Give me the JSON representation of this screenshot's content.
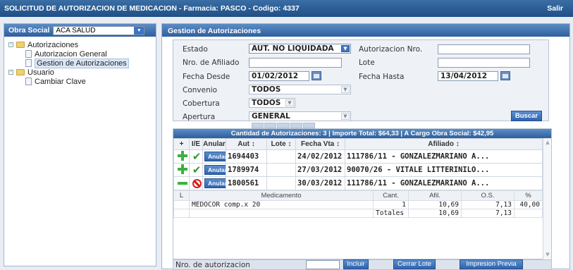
{
  "topbar": {
    "title": "SOLICITUD DE AUTORIZACION DE MEDICACION - Farmacia: PASCO - Codigo: 4337",
    "logout": "Salir"
  },
  "sidebar": {
    "obra_social_label": "Obra Social",
    "obra_social_value": "ACA SALUD",
    "tree": {
      "autorizaciones": "Autorizaciones",
      "autorizacion_general": "Autorizacion General",
      "gestion_autorizaciones": "Gestion de Autorizaciones",
      "usuario": "Usuario",
      "cambiar_clave": "Cambiar Clave"
    }
  },
  "main": {
    "title": "Gestion de Autorizaciones",
    "filters": {
      "estado_label": "Estado",
      "estado_value": "AUT. NO LIQUIDADA",
      "autorizacion_nro_label": "Autorizacion Nro.",
      "autorizacion_nro_value": "",
      "nro_afiliado_label": "Nro. de Afiliado",
      "nro_afiliado_value": "",
      "lote_label": "Lote",
      "lote_value": "",
      "fecha_desde_label": "Fecha Desde",
      "fecha_desde_value": "01/02/2012",
      "fecha_hasta_label": "Fecha Hasta",
      "fecha_hasta_value": "13/04/2012",
      "convenio_label": "Convenio",
      "convenio_value": "TODOS",
      "cobertura_label": "Cobertura",
      "cobertura_value": "TODOS",
      "apertura_label": "Apertura",
      "apertura_value": "GENERAL",
      "buscar": "Buscar"
    },
    "grid": {
      "summary": "Cantidad de Autorizaciones: 3 | Importe Total: $64,33 | A Cargo Obra Social: $42,95",
      "headers": {
        "expand": "+",
        "ie": "I/E",
        "anular": "Anular",
        "aut": "Aut ↕",
        "lote": "Lote ↕",
        "fecha_vta": "Fecha Vta ↕",
        "afiliado": "Afiliado ↕"
      },
      "anular_btn": "Anular",
      "rows": [
        {
          "aut": "1694403",
          "lote": "",
          "fecha": "24/02/2012",
          "afiliado": "111786/11 - GONZALEZMARIANO A..."
        },
        {
          "aut": "1789974",
          "lote": "",
          "fecha": "27/03/2012",
          "afiliado": "90070/26 - VITALE LITTERINILO..."
        },
        {
          "aut": "1800561",
          "lote": "",
          "fecha": "30/03/2012",
          "afiliado": "111786/11 - GONZALEZMARIANO A..."
        }
      ],
      "detail": {
        "headers": {
          "l": "L",
          "medicamento": "Medicamento",
          "cant": "Cant.",
          "afil": "Afil.",
          "os": "O.S.",
          "pct": "%"
        },
        "row": {
          "medicamento": "MEDOCOR comp.x 20",
          "cant": "1",
          "afil": "10,69",
          "os": "7,13",
          "pct": "40,00"
        },
        "totals": {
          "label": "Totales",
          "afil": "10,69",
          "os": "7,13"
        }
      }
    },
    "bottom": {
      "nro_autorizacion_label": "Nro. de autorizacion",
      "nro_autorizacion_value": "",
      "incluir": "Incluir",
      "cerrar_lote": "Cerrar Lote",
      "impresion_previa": "Impresion Previa"
    }
  }
}
